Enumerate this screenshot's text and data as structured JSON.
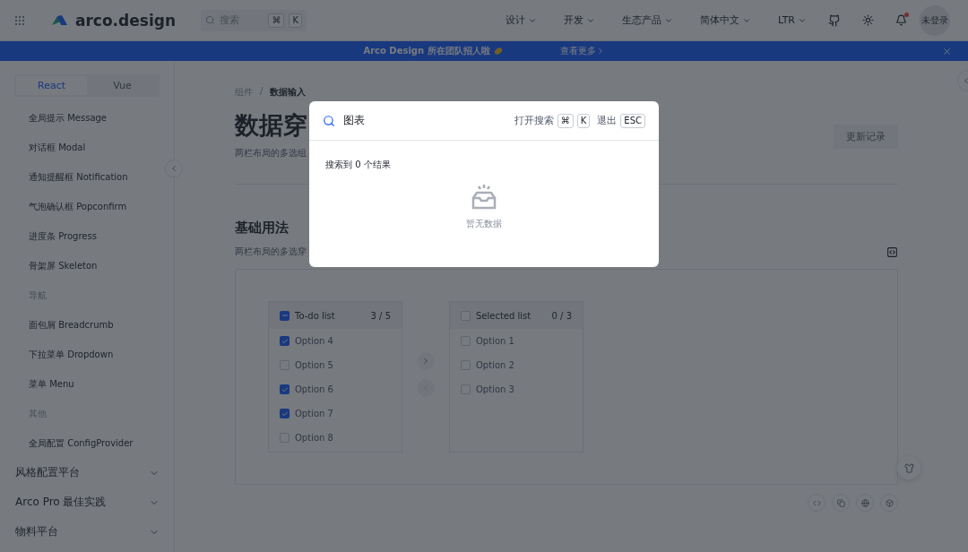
{
  "header": {
    "logo": "arco.design",
    "search": {
      "placeholder": "搜索",
      "keys": [
        "⌘",
        "K"
      ]
    },
    "nav": [
      {
        "label": "设计"
      },
      {
        "label": "开发"
      },
      {
        "label": "生态产品"
      },
      {
        "label": "简体中文"
      },
      {
        "label": "LTR"
      }
    ],
    "notification_dot": true,
    "avatar": "未登录"
  },
  "banner": {
    "text": "Arco Design 所在团队招人啦",
    "link": "查看更多"
  },
  "sidebar": {
    "tabs": [
      {
        "label": "React",
        "selected": true
      },
      {
        "label": "Vue",
        "selected": false
      }
    ],
    "items": [
      {
        "kind": "link",
        "label": "全局提示 Message"
      },
      {
        "kind": "link",
        "label": "对话框 Modal"
      },
      {
        "kind": "link",
        "label": "通知提醒框 Notification"
      },
      {
        "kind": "link",
        "label": "气泡确认框 Popconfirm"
      },
      {
        "kind": "link",
        "label": "进度条 Progress"
      },
      {
        "kind": "link",
        "label": "骨架屏 Skeleton"
      },
      {
        "kind": "group",
        "label": "导航"
      },
      {
        "kind": "link",
        "label": "面包屑 Breadcrumb"
      },
      {
        "kind": "link",
        "label": "下拉菜单 Dropdown"
      },
      {
        "kind": "link",
        "label": "菜单 Menu"
      },
      {
        "kind": "group",
        "label": "其他"
      },
      {
        "kind": "link",
        "label": "全局配置 ConfigProvider"
      }
    ],
    "sections": [
      {
        "label": "风格配置平台",
        "expanded": false
      },
      {
        "label": "Arco Pro 最佳实践",
        "expanded": false
      },
      {
        "label": "物料平台",
        "expanded": false
      }
    ]
  },
  "content": {
    "breadcrumb": [
      "组件",
      "数据输入"
    ],
    "breadcrumb_separator": "/",
    "title": "数据穿",
    "subtitle": "两栏布局的多选组",
    "changelog_button": "更新记录",
    "section_title": "基础用法",
    "section_desc": "两栏布局的多选穿",
    "transfer": {
      "lists": [
        {
          "title": "To-do list",
          "count": "3 / 5",
          "checked": false,
          "indeterminate": true,
          "items": [
            {
              "label": "Option 4",
              "checked": true
            },
            {
              "label": "Option 5",
              "checked": false
            },
            {
              "label": "Option 6",
              "checked": true
            },
            {
              "label": "Option 7",
              "checked": true
            },
            {
              "label": "Option 8",
              "checked": false
            }
          ]
        },
        {
          "title": "Selected list",
          "count": "0 / 3",
          "checked": false,
          "indeterminate": false,
          "items": [
            {
              "label": "Option 1",
              "checked": false
            },
            {
              "label": "Option 2",
              "checked": false
            },
            {
              "label": "Option 3",
              "checked": false
            }
          ]
        }
      ],
      "move_right_disabled": false,
      "move_left_disabled": true
    }
  },
  "search_modal": {
    "query": "图表",
    "open_hint": "打开搜索",
    "open_keys": [
      "⌘",
      "K"
    ],
    "exit_hint": "退出",
    "exit_key": "ESC",
    "result": "搜索到 0 个结果",
    "empty": "暂无数据"
  }
}
